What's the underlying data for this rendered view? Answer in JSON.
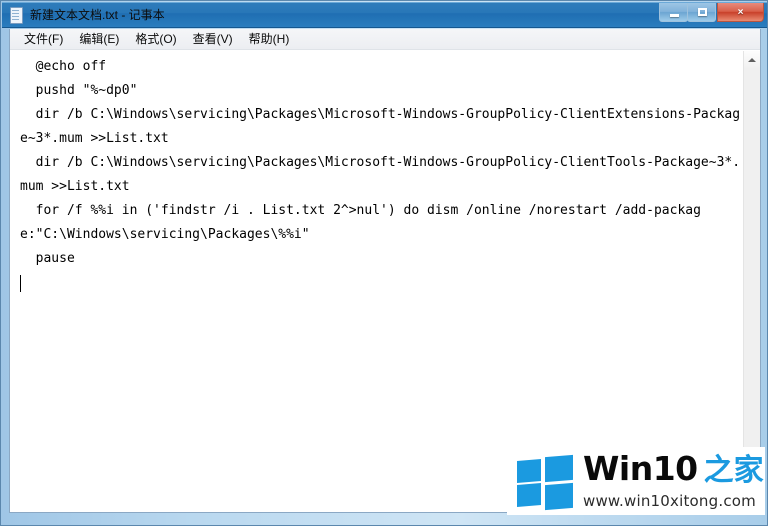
{
  "window": {
    "title": "新建文本文档.txt - 记事本",
    "icon": "notepad-document-icon",
    "controls": {
      "minimize_label": "最小化",
      "maximize_label": "最大化",
      "close_label": "×"
    }
  },
  "menubar": {
    "items": [
      {
        "label": "文件(F)"
      },
      {
        "label": "编辑(E)"
      },
      {
        "label": "格式(O)"
      },
      {
        "label": "查看(V)"
      },
      {
        "label": "帮助(H)"
      }
    ]
  },
  "editor": {
    "lines": [
      "  @echo off",
      "",
      "  pushd \"%~dp0\"",
      "",
      "  dir /b C:\\Windows\\servicing\\Packages\\Microsoft-Windows-GroupPolicy-ClientExtensions-Package~3*.mum >>List.txt",
      "",
      "  dir /b C:\\Windows\\servicing\\Packages\\Microsoft-Windows-GroupPolicy-ClientTools-Package~3*.mum >>List.txt",
      "",
      "  for /f %%i in ('findstr /i . List.txt 2^>nul') do dism /online /norestart /add-package:\"C:\\Windows\\servicing\\Packages\\%%i\"",
      "",
      "  pause"
    ]
  },
  "scrollbar": {
    "up_arrow": "scroll-up-arrow",
    "down_arrow": "scroll-down-arrow"
  },
  "watermark": {
    "brand": "Win10",
    "brand_cn": "之家",
    "url": "www.win10xitong.com",
    "logo_color": "#1b9ae0"
  },
  "colors": {
    "titlebar": "#2877b8",
    "frame": "#b9d8ef",
    "close_button": "#c9402a",
    "accent": "#1b9ae0"
  }
}
